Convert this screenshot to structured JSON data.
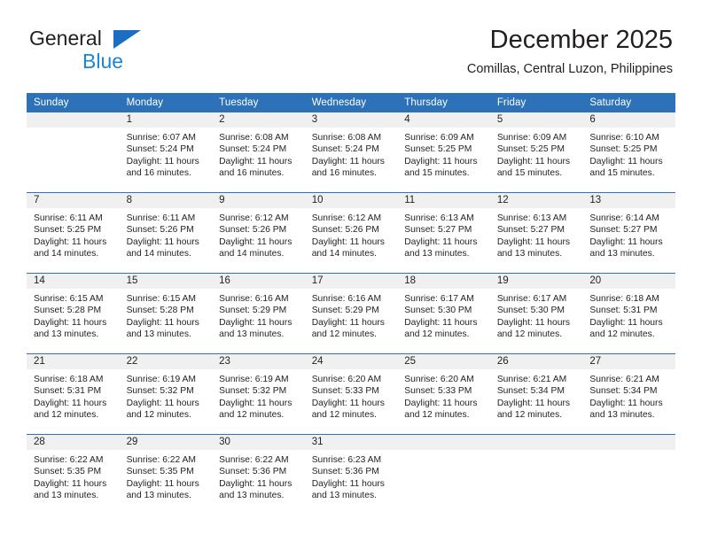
{
  "brand": {
    "name_part1": "General",
    "name_part2": "Blue",
    "triangle_color": "#1b6ec2",
    "text_color": "#231f20",
    "blue_text_color": "#1b85d6"
  },
  "header": {
    "title": "December 2025",
    "subtitle": "Comillas, Central Luzon, Philippines"
  },
  "theme": {
    "header_blue": "#2d72b8",
    "row_divider_blue": "#2d72b8",
    "daynum_band_gray": "#f0f0f0",
    "text": "#231f20"
  },
  "weekday_headers": [
    "Sunday",
    "Monday",
    "Tuesday",
    "Wednesday",
    "Thursday",
    "Friday",
    "Saturday"
  ],
  "weeks": [
    [
      {
        "day": "",
        "sunrise": "",
        "sunset": "",
        "daylight_line1": "",
        "daylight_line2": "",
        "empty": true
      },
      {
        "day": "1",
        "sunrise": "Sunrise: 6:07 AM",
        "sunset": "Sunset: 5:24 PM",
        "daylight_line1": "Daylight: 11 hours",
        "daylight_line2": "and 16 minutes.",
        "empty": false
      },
      {
        "day": "2",
        "sunrise": "Sunrise: 6:08 AM",
        "sunset": "Sunset: 5:24 PM",
        "daylight_line1": "Daylight: 11 hours",
        "daylight_line2": "and 16 minutes.",
        "empty": false
      },
      {
        "day": "3",
        "sunrise": "Sunrise: 6:08 AM",
        "sunset": "Sunset: 5:24 PM",
        "daylight_line1": "Daylight: 11 hours",
        "daylight_line2": "and 16 minutes.",
        "empty": false
      },
      {
        "day": "4",
        "sunrise": "Sunrise: 6:09 AM",
        "sunset": "Sunset: 5:25 PM",
        "daylight_line1": "Daylight: 11 hours",
        "daylight_line2": "and 15 minutes.",
        "empty": false
      },
      {
        "day": "5",
        "sunrise": "Sunrise: 6:09 AM",
        "sunset": "Sunset: 5:25 PM",
        "daylight_line1": "Daylight: 11 hours",
        "daylight_line2": "and 15 minutes.",
        "empty": false
      },
      {
        "day": "6",
        "sunrise": "Sunrise: 6:10 AM",
        "sunset": "Sunset: 5:25 PM",
        "daylight_line1": "Daylight: 11 hours",
        "daylight_line2": "and 15 minutes.",
        "empty": false
      }
    ],
    [
      {
        "day": "7",
        "sunrise": "Sunrise: 6:11 AM",
        "sunset": "Sunset: 5:25 PM",
        "daylight_line1": "Daylight: 11 hours",
        "daylight_line2": "and 14 minutes.",
        "empty": false
      },
      {
        "day": "8",
        "sunrise": "Sunrise: 6:11 AM",
        "sunset": "Sunset: 5:26 PM",
        "daylight_line1": "Daylight: 11 hours",
        "daylight_line2": "and 14 minutes.",
        "empty": false
      },
      {
        "day": "9",
        "sunrise": "Sunrise: 6:12 AM",
        "sunset": "Sunset: 5:26 PM",
        "daylight_line1": "Daylight: 11 hours",
        "daylight_line2": "and 14 minutes.",
        "empty": false
      },
      {
        "day": "10",
        "sunrise": "Sunrise: 6:12 AM",
        "sunset": "Sunset: 5:26 PM",
        "daylight_line1": "Daylight: 11 hours",
        "daylight_line2": "and 14 minutes.",
        "empty": false
      },
      {
        "day": "11",
        "sunrise": "Sunrise: 6:13 AM",
        "sunset": "Sunset: 5:27 PM",
        "daylight_line1": "Daylight: 11 hours",
        "daylight_line2": "and 13 minutes.",
        "empty": false
      },
      {
        "day": "12",
        "sunrise": "Sunrise: 6:13 AM",
        "sunset": "Sunset: 5:27 PM",
        "daylight_line1": "Daylight: 11 hours",
        "daylight_line2": "and 13 minutes.",
        "empty": false
      },
      {
        "day": "13",
        "sunrise": "Sunrise: 6:14 AM",
        "sunset": "Sunset: 5:27 PM",
        "daylight_line1": "Daylight: 11 hours",
        "daylight_line2": "and 13 minutes.",
        "empty": false
      }
    ],
    [
      {
        "day": "14",
        "sunrise": "Sunrise: 6:15 AM",
        "sunset": "Sunset: 5:28 PM",
        "daylight_line1": "Daylight: 11 hours",
        "daylight_line2": "and 13 minutes.",
        "empty": false
      },
      {
        "day": "15",
        "sunrise": "Sunrise: 6:15 AM",
        "sunset": "Sunset: 5:28 PM",
        "daylight_line1": "Daylight: 11 hours",
        "daylight_line2": "and 13 minutes.",
        "empty": false
      },
      {
        "day": "16",
        "sunrise": "Sunrise: 6:16 AM",
        "sunset": "Sunset: 5:29 PM",
        "daylight_line1": "Daylight: 11 hours",
        "daylight_line2": "and 13 minutes.",
        "empty": false
      },
      {
        "day": "17",
        "sunrise": "Sunrise: 6:16 AM",
        "sunset": "Sunset: 5:29 PM",
        "daylight_line1": "Daylight: 11 hours",
        "daylight_line2": "and 12 minutes.",
        "empty": false
      },
      {
        "day": "18",
        "sunrise": "Sunrise: 6:17 AM",
        "sunset": "Sunset: 5:30 PM",
        "daylight_line1": "Daylight: 11 hours",
        "daylight_line2": "and 12 minutes.",
        "empty": false
      },
      {
        "day": "19",
        "sunrise": "Sunrise: 6:17 AM",
        "sunset": "Sunset: 5:30 PM",
        "daylight_line1": "Daylight: 11 hours",
        "daylight_line2": "and 12 minutes.",
        "empty": false
      },
      {
        "day": "20",
        "sunrise": "Sunrise: 6:18 AM",
        "sunset": "Sunset: 5:31 PM",
        "daylight_line1": "Daylight: 11 hours",
        "daylight_line2": "and 12 minutes.",
        "empty": false
      }
    ],
    [
      {
        "day": "21",
        "sunrise": "Sunrise: 6:18 AM",
        "sunset": "Sunset: 5:31 PM",
        "daylight_line1": "Daylight: 11 hours",
        "daylight_line2": "and 12 minutes.",
        "empty": false
      },
      {
        "day": "22",
        "sunrise": "Sunrise: 6:19 AM",
        "sunset": "Sunset: 5:32 PM",
        "daylight_line1": "Daylight: 11 hours",
        "daylight_line2": "and 12 minutes.",
        "empty": false
      },
      {
        "day": "23",
        "sunrise": "Sunrise: 6:19 AM",
        "sunset": "Sunset: 5:32 PM",
        "daylight_line1": "Daylight: 11 hours",
        "daylight_line2": "and 12 minutes.",
        "empty": false
      },
      {
        "day": "24",
        "sunrise": "Sunrise: 6:20 AM",
        "sunset": "Sunset: 5:33 PM",
        "daylight_line1": "Daylight: 11 hours",
        "daylight_line2": "and 12 minutes.",
        "empty": false
      },
      {
        "day": "25",
        "sunrise": "Sunrise: 6:20 AM",
        "sunset": "Sunset: 5:33 PM",
        "daylight_line1": "Daylight: 11 hours",
        "daylight_line2": "and 12 minutes.",
        "empty": false
      },
      {
        "day": "26",
        "sunrise": "Sunrise: 6:21 AM",
        "sunset": "Sunset: 5:34 PM",
        "daylight_line1": "Daylight: 11 hours",
        "daylight_line2": "and 12 minutes.",
        "empty": false
      },
      {
        "day": "27",
        "sunrise": "Sunrise: 6:21 AM",
        "sunset": "Sunset: 5:34 PM",
        "daylight_line1": "Daylight: 11 hours",
        "daylight_line2": "and 13 minutes.",
        "empty": false
      }
    ],
    [
      {
        "day": "28",
        "sunrise": "Sunrise: 6:22 AM",
        "sunset": "Sunset: 5:35 PM",
        "daylight_line1": "Daylight: 11 hours",
        "daylight_line2": "and 13 minutes.",
        "empty": false
      },
      {
        "day": "29",
        "sunrise": "Sunrise: 6:22 AM",
        "sunset": "Sunset: 5:35 PM",
        "daylight_line1": "Daylight: 11 hours",
        "daylight_line2": "and 13 minutes.",
        "empty": false
      },
      {
        "day": "30",
        "sunrise": "Sunrise: 6:22 AM",
        "sunset": "Sunset: 5:36 PM",
        "daylight_line1": "Daylight: 11 hours",
        "daylight_line2": "and 13 minutes.",
        "empty": false
      },
      {
        "day": "31",
        "sunrise": "Sunrise: 6:23 AM",
        "sunset": "Sunset: 5:36 PM",
        "daylight_line1": "Daylight: 11 hours",
        "daylight_line2": "and 13 minutes.",
        "empty": false
      },
      {
        "day": "",
        "sunrise": "",
        "sunset": "",
        "daylight_line1": "",
        "daylight_line2": "",
        "empty": true
      },
      {
        "day": "",
        "sunrise": "",
        "sunset": "",
        "daylight_line1": "",
        "daylight_line2": "",
        "empty": true
      },
      {
        "day": "",
        "sunrise": "",
        "sunset": "",
        "daylight_line1": "",
        "daylight_line2": "",
        "empty": true
      }
    ]
  ]
}
